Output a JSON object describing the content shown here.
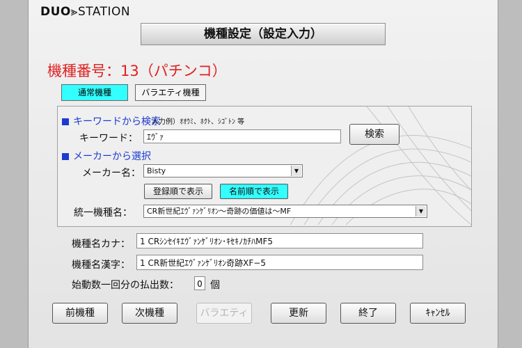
{
  "app": {
    "logo_bold": "DUO",
    "logo_rest": "STATION",
    "title": "機種設定（設定入力）"
  },
  "model_heading": "機種番号：13（パチンコ）",
  "tabs": [
    {
      "label": "通常機種",
      "active": true
    },
    {
      "label": "バラエティ機種",
      "active": false
    }
  ],
  "keyword_search": {
    "section_title": "キーワードから検索",
    "example": "入力例）ｵｵｳﾐ、ﾎｸﾄ、ｼｺﾞﾄﾝ 等",
    "keyword_label": "キーワード：",
    "keyword_value": "ｴｳﾞｧ",
    "search_button": "検索"
  },
  "maker_select": {
    "section_title": "メーカーから選択",
    "maker_label": "メーカー名：",
    "maker_value": "Bisty",
    "sort_registered": "登録順で表示",
    "sort_name": "名前順で表示",
    "unified_label": "統一機種名：",
    "unified_value": "CR新世紀ｴｳﾞｧﾝｹﾞﾘｵﾝ〜奇跡の価値は〜MF"
  },
  "fields": {
    "kana_label": "機種名カナ：",
    "kana_value": "1 CRｼﾝｾｲｷｴｳﾞｧﾝｹﾞﾘｵﾝ･ｷｾｷﾉｶﾁﾊMF5",
    "kanji_label": "機種名漢字：",
    "kanji_value": "1 CR新世紀ｴｳﾞｧﾝｹﾞﾘｵﾝ奇跡XF−5",
    "payout_label": "始動数一回分の払出数：",
    "payout_value": "0",
    "payout_unit": "個"
  },
  "buttons": {
    "prev": "前機種",
    "next": "次機種",
    "variety": "バラエティ",
    "update": "更新",
    "finish": "終了",
    "cancel": "ｷｬﾝｾﾙ"
  },
  "colors": {
    "heading": "#e02020",
    "section": "#1c3bd0",
    "active": "#33ffff"
  }
}
